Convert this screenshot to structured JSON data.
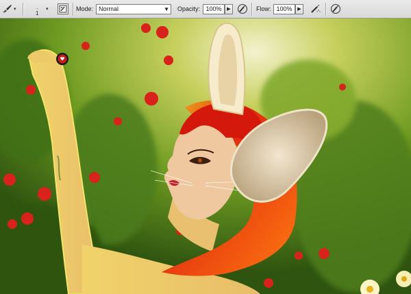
{
  "options_bar": {
    "brush_size": "1",
    "mode_label": "Mode:",
    "mode_value": "Normal",
    "opacity_label": "Opacity:",
    "opacity_value": "100%",
    "flow_label": "Flow:",
    "flow_value": "100%"
  },
  "icons": {
    "tool_preset": "brush-icon",
    "brush_panel": "brush-panel-icon",
    "pressure_opacity": "tablet-pressure-icon",
    "airbrush": "airbrush-icon",
    "pressure_size": "tablet-pressure-icon"
  },
  "colors": {
    "toolbar_bg": "#dedede",
    "hair": "#d81e0f",
    "background_foliage": "#6e9a1c"
  }
}
